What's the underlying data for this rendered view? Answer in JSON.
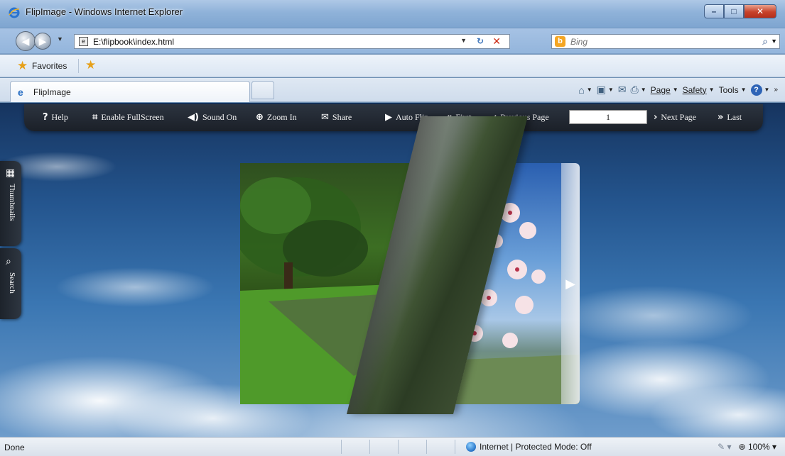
{
  "window": {
    "title": "FlipImage - Windows Internet Explorer",
    "min": "–",
    "max": "□",
    "close": "✕"
  },
  "address_bar": {
    "url": "E:\\flipbook\\index.html"
  },
  "search_bar": {
    "placeholder": "Bing",
    "logo": "b"
  },
  "favorites_bar": {
    "label": "Favorites"
  },
  "tab": {
    "label": "FlipImage"
  },
  "commands": {
    "page": "Page",
    "safety": "Safety",
    "tools": "Tools"
  },
  "flipbook_toolbar": {
    "help": "Help",
    "fullscreen": "Enable FullScreen",
    "sound": "Sound On",
    "zoom": "Zoom In",
    "share": "Share",
    "autoflip": "Auto Flip",
    "first": "First",
    "previous": "Previous Page",
    "page_number": "1",
    "next": "Next Page",
    "last": "Last"
  },
  "side_tabs": {
    "thumbnails": "Thumbnails",
    "search": "Search"
  },
  "status_bar": {
    "status": "Done",
    "zone": "Internet | Protected Mode: Off",
    "zoom": "100%"
  },
  "icons": [
    "ie-icon",
    "back-icon",
    "forward-icon",
    "refresh-icon",
    "stop-icon",
    "search-icon",
    "favorites-star-icon",
    "add-favorite-icon",
    "home-icon",
    "feeds-icon",
    "mail-icon",
    "print-icon",
    "help-icon",
    "help-circle-icon",
    "fullscreen-icon",
    "speaker-icon",
    "zoom-icon",
    "mail-share-icon",
    "play-icon",
    "double-left-icon",
    "left-chevron-icon",
    "right-chevron-icon",
    "double-right-icon",
    "grid-icon",
    "magnifier-icon",
    "next-page-arrow-icon",
    "globe-icon",
    "zoom-status-icon"
  ],
  "colors": {
    "toolbar_bg": "#1b2028",
    "sky_top": "#16345f",
    "sky_bottom": "#6e9ccb"
  }
}
